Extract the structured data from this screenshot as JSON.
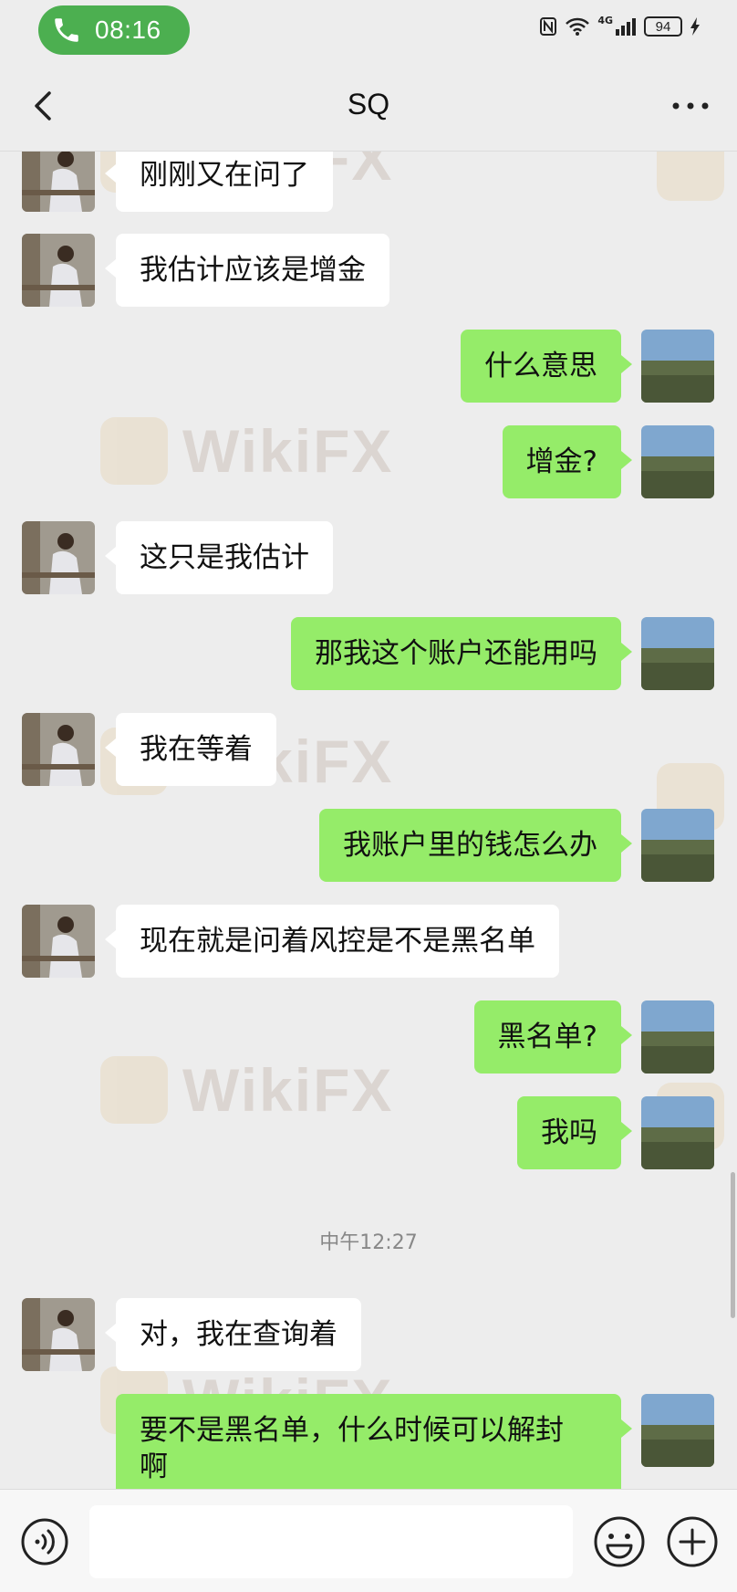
{
  "status_bar": {
    "time": "08:16",
    "network": "4G",
    "battery": "94"
  },
  "header": {
    "title": "SQ"
  },
  "messages": [
    {
      "side": "in",
      "text": "刚刚又在问了"
    },
    {
      "side": "in",
      "text": "我估计应该是增金"
    },
    {
      "side": "out",
      "text": "什么意思"
    },
    {
      "side": "out",
      "text": "增金?"
    },
    {
      "side": "in",
      "text": "这只是我估计"
    },
    {
      "side": "out",
      "text": "那我这个账户还能用吗"
    },
    {
      "side": "in",
      "text": "我在等着"
    },
    {
      "side": "out",
      "text": "我账户里的钱怎么办"
    },
    {
      "side": "in",
      "text": "现在就是问着风控是不是黑名单"
    },
    {
      "side": "out",
      "text": "黑名单?"
    },
    {
      "side": "out",
      "text": "我吗"
    },
    {
      "side": "in",
      "text": "对，我在查询着"
    },
    {
      "side": "out",
      "text": "要不是黑名单，什么时候可以解封\n啊"
    }
  ],
  "timestamp": "中午12:27",
  "watermark": "WikiFX",
  "colors": {
    "background": "#ededed",
    "outgoing_bubble": "#95ec69",
    "incoming_bubble": "#ffffff",
    "call_pill": "#4caf50"
  },
  "icons": {
    "call": "phone-icon",
    "back": "chevron-left-icon",
    "more": "more-dots-icon",
    "voice": "voice-icon",
    "emoji": "emoji-icon",
    "plus": "plus-icon"
  }
}
